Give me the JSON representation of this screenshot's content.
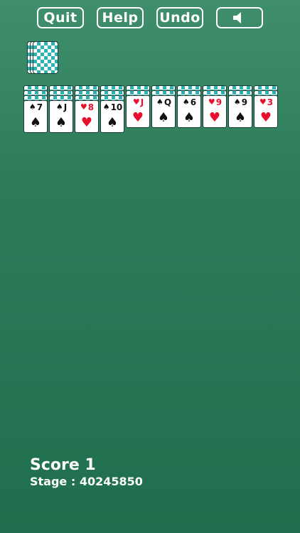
{
  "toolbar": {
    "quit_label": "Quit",
    "help_label": "Help",
    "undo_label": "Undo",
    "sound_icon": "speaker-icon"
  },
  "stock": {
    "piles_visible": 3
  },
  "tableau": [
    {
      "hidden": 3,
      "face": {
        "rank": "7",
        "suit": "♠",
        "color": "black"
      }
    },
    {
      "hidden": 3,
      "face": {
        "rank": "J",
        "suit": "♠",
        "color": "black"
      }
    },
    {
      "hidden": 3,
      "face": {
        "rank": "8",
        "suit": "♥",
        "color": "red"
      }
    },
    {
      "hidden": 3,
      "face": {
        "rank": "10",
        "suit": "♠",
        "color": "black"
      }
    },
    {
      "hidden": 2,
      "face": {
        "rank": "J",
        "suit": "♥",
        "color": "red"
      }
    },
    {
      "hidden": 2,
      "face": {
        "rank": "Q",
        "suit": "♠",
        "color": "black"
      }
    },
    {
      "hidden": 2,
      "face": {
        "rank": "6",
        "suit": "♠",
        "color": "black"
      }
    },
    {
      "hidden": 2,
      "face": {
        "rank": "9",
        "suit": "♥",
        "color": "red"
      }
    },
    {
      "hidden": 2,
      "face": {
        "rank": "9",
        "suit": "♠",
        "color": "black"
      }
    },
    {
      "hidden": 2,
      "face": {
        "rank": "3",
        "suit": "♥",
        "color": "red"
      }
    }
  ],
  "status": {
    "score": "Score 1",
    "stage": "Stage : 40245850"
  },
  "colors": {
    "background_top": "#3f8f6c",
    "background_bottom": "#1f6f4e",
    "card_back": "#2fb3b0",
    "red_suit": "#e8112d"
  }
}
